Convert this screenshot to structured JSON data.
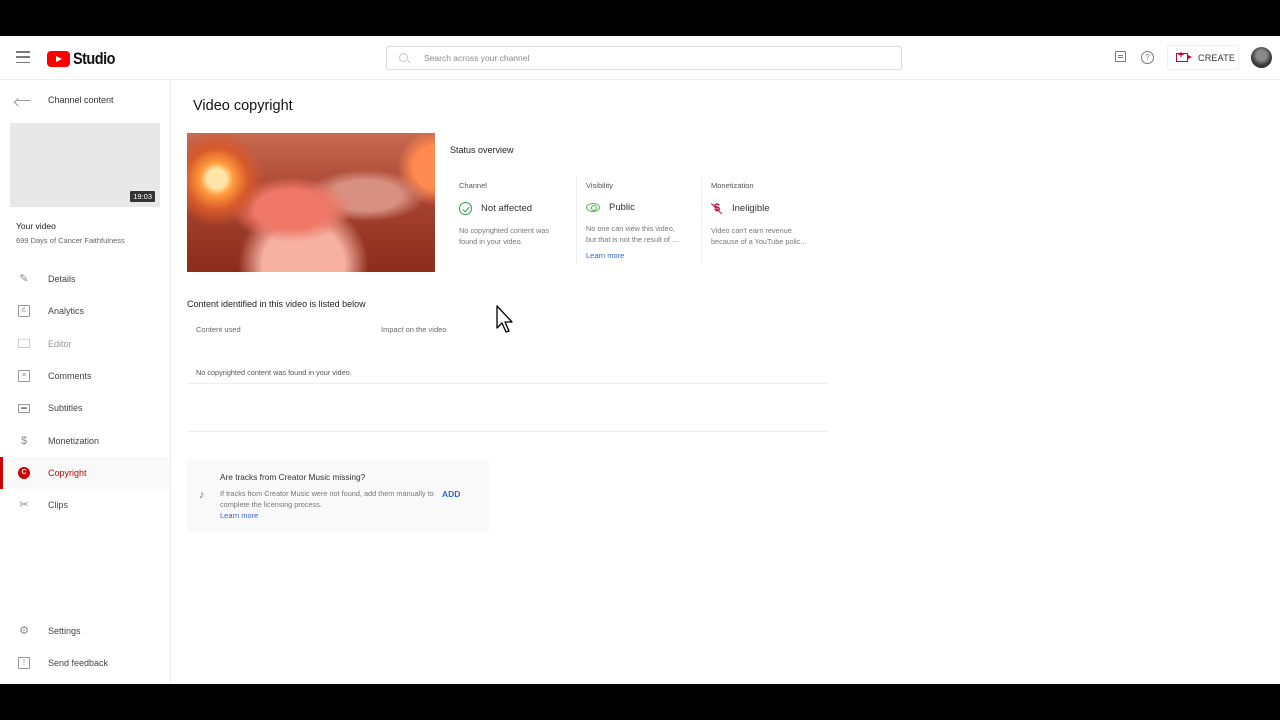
{
  "header": {
    "app_name": "Studio",
    "search_placeholder": "Search across your channel",
    "create_label": "CREATE",
    "icons": {
      "menu": "hamburger-icon",
      "messages": "messages-icon",
      "help": "help-icon",
      "create": "video-plus-icon",
      "avatar": "account-avatar"
    }
  },
  "sidebar": {
    "back_label": "Channel content",
    "thumbnail_duration": "19:03",
    "your_video_label": "Your video",
    "video_title": "699 Days of Cancer Faithfulness",
    "items": [
      {
        "label": "Details",
        "icon": "pencil-icon",
        "state": "normal"
      },
      {
        "label": "Analytics",
        "icon": "analytics-icon",
        "state": "normal"
      },
      {
        "label": "Editor",
        "icon": "editor-icon",
        "state": "disabled"
      },
      {
        "label": "Comments",
        "icon": "comments-icon",
        "state": "normal"
      },
      {
        "label": "Subtitles",
        "icon": "subtitles-icon",
        "state": "normal"
      },
      {
        "label": "Monetization",
        "icon": "dollar-icon",
        "state": "normal"
      },
      {
        "label": "Copyright",
        "icon": "copyright-icon",
        "state": "active"
      },
      {
        "label": "Clips",
        "icon": "scissors-icon",
        "state": "normal"
      }
    ],
    "bottom_items": [
      {
        "label": "Settings",
        "icon": "gear-icon"
      },
      {
        "label": "Send feedback",
        "icon": "feedback-icon"
      }
    ],
    "active_color": "#cc0000"
  },
  "main": {
    "page_title": "Video copyright",
    "status_overview": {
      "title": "Status overview",
      "cards": [
        {
          "label": "Channel",
          "value": "Not affected",
          "icon": "check-circle-icon",
          "description_lines": [
            "No copyrighted content was",
            "found in your video."
          ],
          "link": ""
        },
        {
          "label": "Visibility",
          "value": "Public",
          "icon": "eye-icon",
          "description_lines": [
            "No one can view this video,",
            "but that is not the result of ..."
          ],
          "link": "Learn more"
        },
        {
          "label": "Monetization",
          "value": "Ineligible",
          "icon": "no-monetization-icon",
          "description_lines": [
            "Video can't earn revenue",
            "because of a YouTube polic..."
          ],
          "link": ""
        }
      ]
    },
    "content_section": {
      "title": "Content identified in this video is listed below",
      "columns": [
        "Content used",
        "Impact on the video"
      ],
      "empty_message": "No copyrighted content was found in your video."
    },
    "creator_music": {
      "title": "Are tracks from Creator Music missing?",
      "description": "If tracks from Creator Music were not found, add them manually to complete the licensing process.",
      "link": "Learn more",
      "button": "ADD"
    }
  },
  "colors": {
    "brand_red": "#ff0000",
    "link_blue": "#3366cc",
    "success_green": "#2e9b4a",
    "monetization_red": "#b0103a"
  }
}
